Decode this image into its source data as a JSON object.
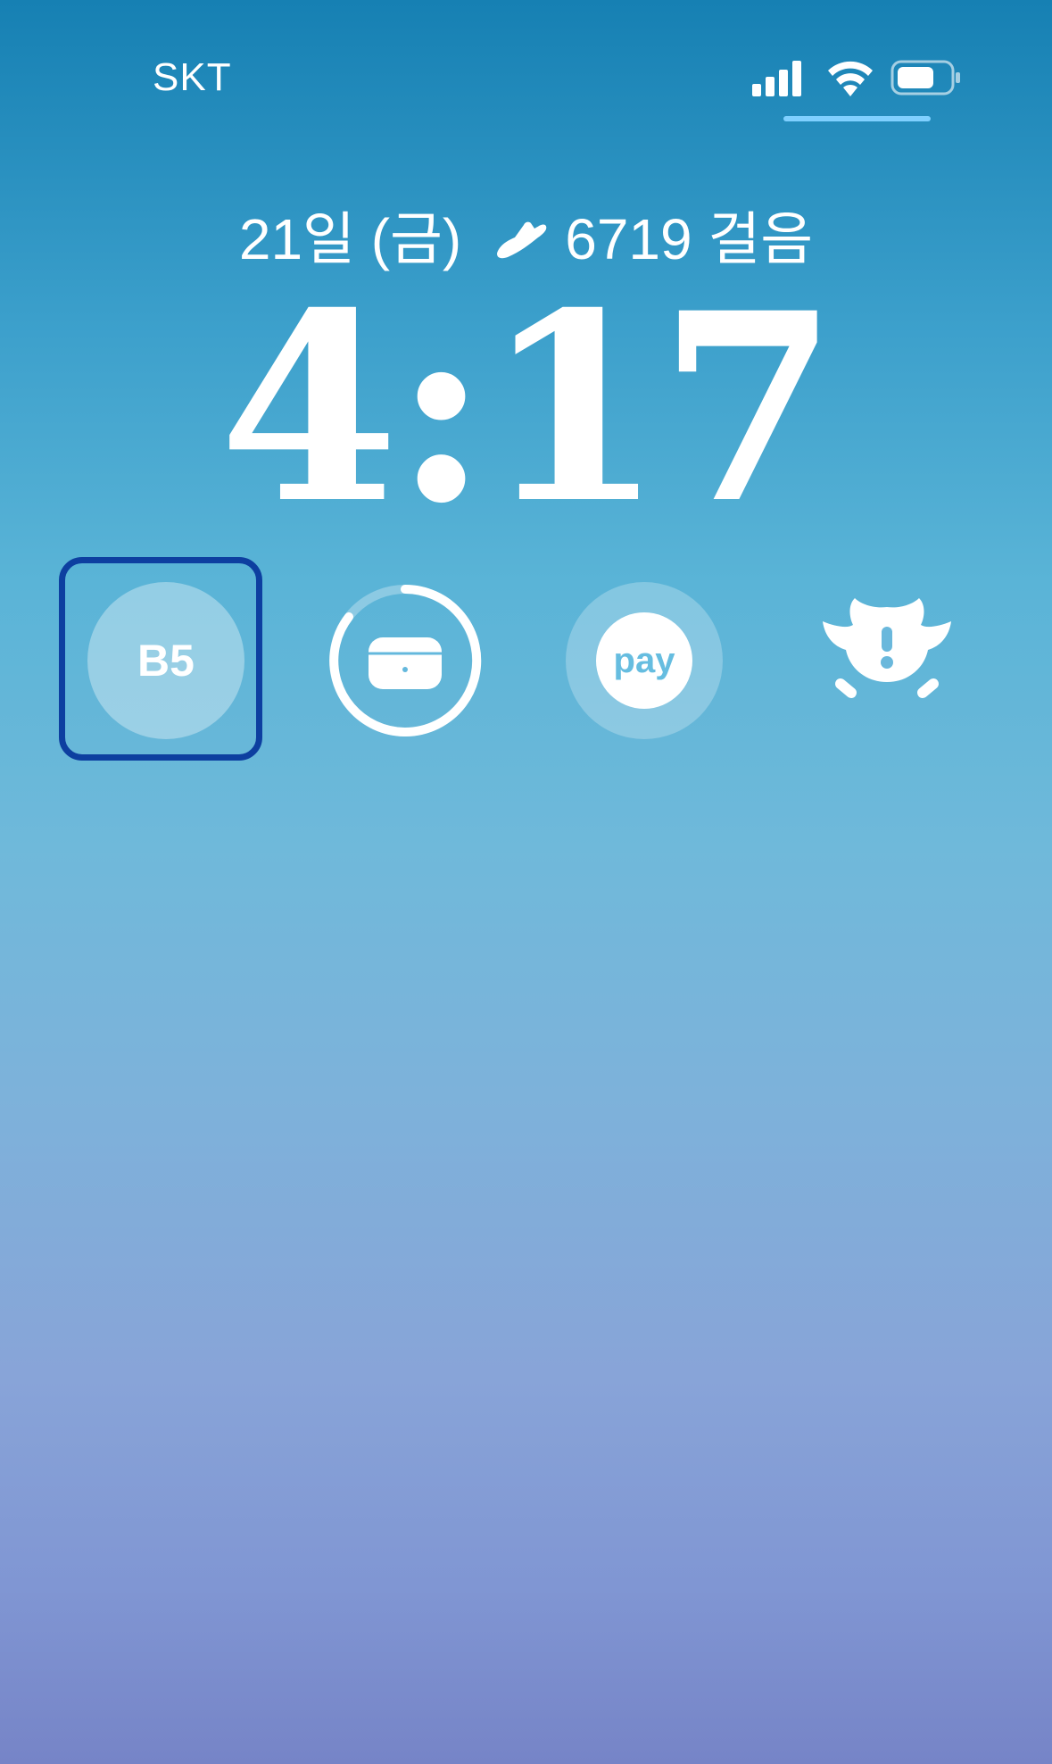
{
  "status_bar": {
    "carrier": "SKT"
  },
  "lock_screen": {
    "date": "21일 (금)",
    "steps": "6719 걸음",
    "time": "4:17"
  },
  "widgets": {
    "reminder_badge": "B5",
    "airpods_icon": "airpods-case-icon",
    "pay_label": "pay",
    "owl_icon": "owl-alert-icon"
  },
  "colors": {
    "background_top": "#1680b3",
    "background_bottom": "#7684c7",
    "focus_ring": "#0d3fa0",
    "accent_line": "#7fd0ff"
  }
}
